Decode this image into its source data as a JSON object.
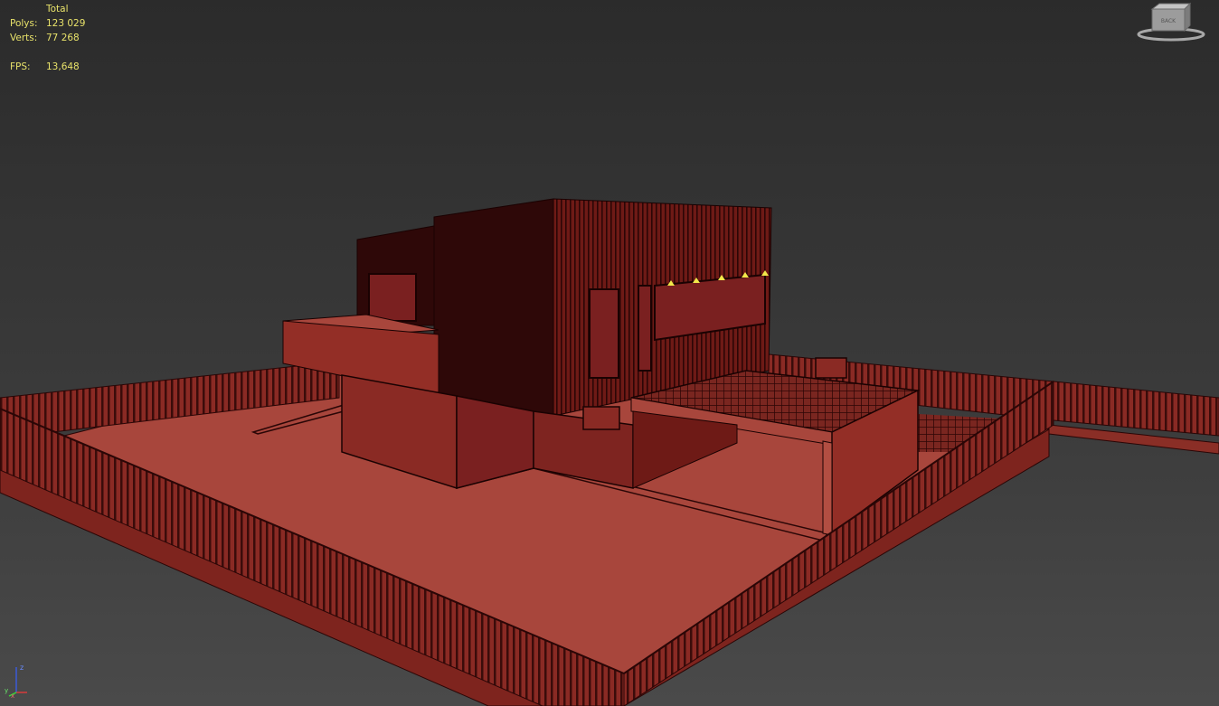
{
  "stats": {
    "header": "Total",
    "polys_label": "Polys:",
    "polys_value": "123 029",
    "verts_label": "Verts:",
    "verts_value": "77 268",
    "fps_label": "FPS:",
    "fps_value": "13,648"
  },
  "viewcube": {
    "face_label": "BACK",
    "icon": "viewcube-icon"
  },
  "axis_tripod": {
    "z_label": "z",
    "y_label": "y",
    "x_label": "x"
  },
  "colors": {
    "background": "#333333",
    "model_dark": "#2e0808",
    "model_mid": "#7a2020",
    "model_light": "#a8463c",
    "stats_text": "#e8e26a"
  }
}
